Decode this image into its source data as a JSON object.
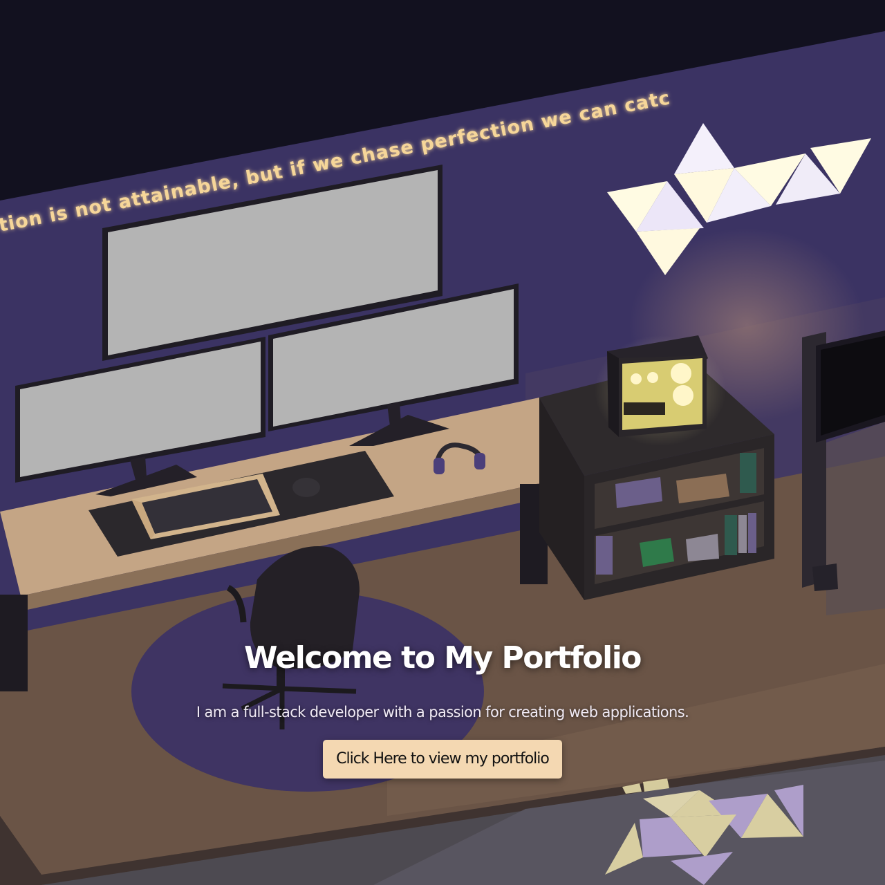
{
  "hero": {
    "title": "Welcome to My Portfolio",
    "subtitle": "I am a full-stack developer with a passion for creating web applications.",
    "cta_label": "Click Here to view my portfolio"
  },
  "scene": {
    "neon_quote": "tion is not attainable, but if we chase perfection we can catch excellence.",
    "colors": {
      "background": "#12111f",
      "wall": "#3b3363",
      "floor": "#6a5446",
      "desk": "#c4a585",
      "neon_text": "#f6d699",
      "light_panel": "#fff9df",
      "rug": "#3f3463",
      "button": "#f4d8b2"
    }
  }
}
